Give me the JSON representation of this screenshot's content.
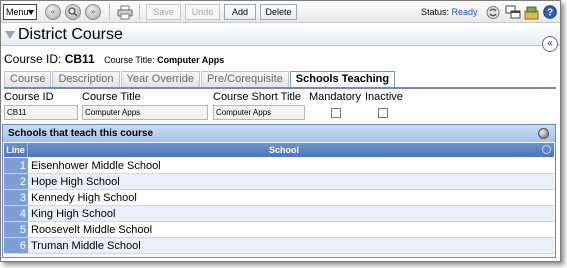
{
  "toolbar": {
    "menu_label": "Menu",
    "save_label": "Save",
    "undo_label": "Undo",
    "add_label": "Add",
    "delete_label": "Delete",
    "status_label": "Status:",
    "status_value": "Ready",
    "icons": [
      "first-record-icon",
      "search-icon",
      "last-record-icon",
      "print-icon",
      "refresh-icon",
      "windows-icon",
      "tools-icon",
      "help-icon"
    ]
  },
  "header": {
    "title": "District Course",
    "course_id_label": "Course ID:",
    "course_id_value": "CB11",
    "course_title_label": "Course Title:",
    "course_title_value": "Computer Apps"
  },
  "tabs": [
    {
      "label": "Course",
      "active": false
    },
    {
      "label": "Description",
      "active": false
    },
    {
      "label": "Year Override",
      "active": false
    },
    {
      "label": "Pre/Corequisite",
      "active": false
    },
    {
      "label": "Schools Teaching",
      "active": true
    }
  ],
  "fields": {
    "course_id": {
      "label": "Course ID",
      "value": "CB11"
    },
    "course_title": {
      "label": "Course Title",
      "value": "Computer Apps"
    },
    "course_short_title": {
      "label": "Course Short Title",
      "value": "Computer Apps"
    },
    "mandatory": {
      "label": "Mandatory",
      "checked": false
    },
    "inactive": {
      "label": "Inactive",
      "checked": false
    }
  },
  "schools_panel": {
    "title": "Schools that teach this course",
    "columns": [
      "Line",
      "School"
    ],
    "rows": [
      {
        "line": "1",
        "school": "Eisenhower Middle School"
      },
      {
        "line": "2",
        "school": "Hope High School"
      },
      {
        "line": "3",
        "school": "Kennedy High School"
      },
      {
        "line": "4",
        "school": "King High School"
      },
      {
        "line": "5",
        "school": "Roosevelt Middle School"
      },
      {
        "line": "6",
        "school": "Truman Middle School"
      }
    ]
  },
  "colors": {
    "accent": "#4d75b8",
    "status_ready": "#1a4ec0"
  }
}
